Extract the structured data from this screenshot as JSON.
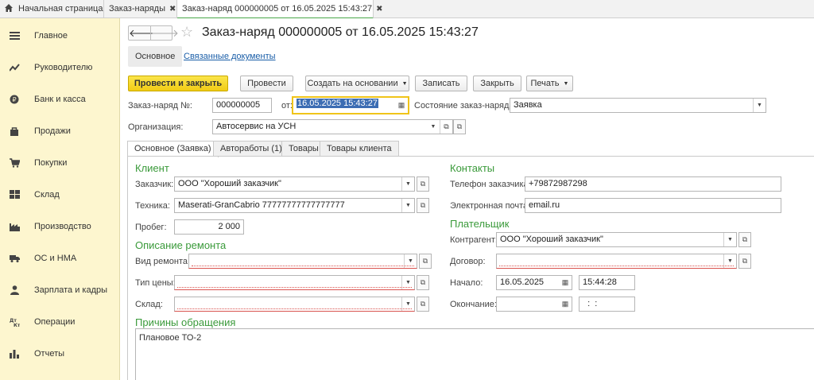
{
  "top_tabs": [
    {
      "label": "Начальная страница"
    },
    {
      "label": "Заказ-наряды"
    },
    {
      "label": "Заказ-наряд 000000005 от 16.05.2025 15:43:27"
    }
  ],
  "sidebar": {
    "items": [
      {
        "label": "Главное",
        "icon": "menu-icon"
      },
      {
        "label": "Руководителю",
        "icon": "trend-icon"
      },
      {
        "label": "Банк и касса",
        "icon": "coin-icon"
      },
      {
        "label": "Продажи",
        "icon": "bag-icon"
      },
      {
        "label": "Покупки",
        "icon": "cart-icon"
      },
      {
        "label": "Склад",
        "icon": "warehouse-icon"
      },
      {
        "label": "Производство",
        "icon": "factory-icon"
      },
      {
        "label": "ОС и НМА",
        "icon": "truck-icon"
      },
      {
        "label": "Зарплата и кадры",
        "icon": "person-icon"
      },
      {
        "label": "Операции",
        "icon": "operations-icon"
      },
      {
        "label": "Отчеты",
        "icon": "reports-icon"
      }
    ]
  },
  "header": {
    "title": "Заказ-наряд 000000005 от 16.05.2025 15:43:27",
    "subtabs": {
      "main": "Основное",
      "related": "Связанные документы"
    }
  },
  "toolbar": {
    "post_close": "Провести и закрыть",
    "post": "Провести",
    "create_based": "Создать на основании",
    "save": "Записать",
    "close": "Закрыть",
    "print": "Печать"
  },
  "form": {
    "order_no_label": "Заказ-наряд №:",
    "order_no": "000000005",
    "from_label": "от:",
    "date": "16.05.2025 15:43:27",
    "state_label": "Состояние заказ-наряда:",
    "state": "Заявка",
    "org_label": "Организация:",
    "org": "Автосервис на УСН"
  },
  "form_tabs": [
    "Основное (Заявка)",
    "Автоработы (1)",
    "Товары",
    "Товары клиента"
  ],
  "client": {
    "section": "Клиент",
    "customer_label": "Заказчик:",
    "customer": "ООО \"Хороший заказчик\"",
    "vehicle_label": "Техника:",
    "vehicle": "Maserati-GranCabrio 77777777777777777",
    "mileage_label": "Пробег:",
    "mileage": "2 000"
  },
  "repair": {
    "section": "Описание ремонта",
    "type_label": "Вид ремонта:",
    "type": "",
    "price_label": "Тип цены:",
    "price": "",
    "warehouse_label": "Склад:",
    "warehouse": ""
  },
  "contacts": {
    "section": "Контакты",
    "phone_label": "Телефон заказчика:",
    "phone": "+79872987298",
    "email_label": "Электронная почта:",
    "email": "email.ru"
  },
  "payer": {
    "section": "Плательщик",
    "counterparty_label": "Контрагент:",
    "counterparty": "ООО \"Хороший заказчик\"",
    "contract_label": "Договор:",
    "contract": "",
    "start_label": "Начало:",
    "start_date": "16.05.2025",
    "start_time": "15:44:28",
    "end_label": "Окончание:",
    "end_date": "  .  .",
    "end_time": "  :  :"
  },
  "reasons": {
    "section": "Причины обращения",
    "text": "Плановое ТО-2"
  }
}
